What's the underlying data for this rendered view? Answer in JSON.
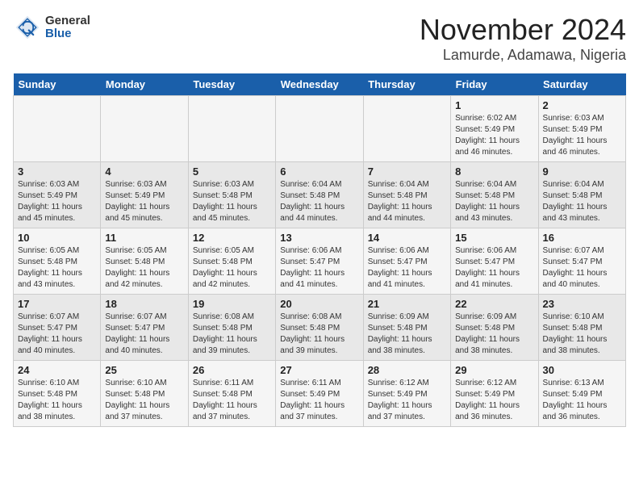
{
  "header": {
    "logo_general": "General",
    "logo_blue": "Blue",
    "month_title": "November 2024",
    "location": "Lamurde, Adamawa, Nigeria"
  },
  "days_of_week": [
    "Sunday",
    "Monday",
    "Tuesday",
    "Wednesday",
    "Thursday",
    "Friday",
    "Saturday"
  ],
  "weeks": [
    [
      {
        "day": "",
        "info": ""
      },
      {
        "day": "",
        "info": ""
      },
      {
        "day": "",
        "info": ""
      },
      {
        "day": "",
        "info": ""
      },
      {
        "day": "",
        "info": ""
      },
      {
        "day": "1",
        "info": "Sunrise: 6:02 AM\nSunset: 5:49 PM\nDaylight: 11 hours and 46 minutes."
      },
      {
        "day": "2",
        "info": "Sunrise: 6:03 AM\nSunset: 5:49 PM\nDaylight: 11 hours and 46 minutes."
      }
    ],
    [
      {
        "day": "3",
        "info": "Sunrise: 6:03 AM\nSunset: 5:49 PM\nDaylight: 11 hours and 45 minutes."
      },
      {
        "day": "4",
        "info": "Sunrise: 6:03 AM\nSunset: 5:49 PM\nDaylight: 11 hours and 45 minutes."
      },
      {
        "day": "5",
        "info": "Sunrise: 6:03 AM\nSunset: 5:48 PM\nDaylight: 11 hours and 45 minutes."
      },
      {
        "day": "6",
        "info": "Sunrise: 6:04 AM\nSunset: 5:48 PM\nDaylight: 11 hours and 44 minutes."
      },
      {
        "day": "7",
        "info": "Sunrise: 6:04 AM\nSunset: 5:48 PM\nDaylight: 11 hours and 44 minutes."
      },
      {
        "day": "8",
        "info": "Sunrise: 6:04 AM\nSunset: 5:48 PM\nDaylight: 11 hours and 43 minutes."
      },
      {
        "day": "9",
        "info": "Sunrise: 6:04 AM\nSunset: 5:48 PM\nDaylight: 11 hours and 43 minutes."
      }
    ],
    [
      {
        "day": "10",
        "info": "Sunrise: 6:05 AM\nSunset: 5:48 PM\nDaylight: 11 hours and 43 minutes."
      },
      {
        "day": "11",
        "info": "Sunrise: 6:05 AM\nSunset: 5:48 PM\nDaylight: 11 hours and 42 minutes."
      },
      {
        "day": "12",
        "info": "Sunrise: 6:05 AM\nSunset: 5:48 PM\nDaylight: 11 hours and 42 minutes."
      },
      {
        "day": "13",
        "info": "Sunrise: 6:06 AM\nSunset: 5:47 PM\nDaylight: 11 hours and 41 minutes."
      },
      {
        "day": "14",
        "info": "Sunrise: 6:06 AM\nSunset: 5:47 PM\nDaylight: 11 hours and 41 minutes."
      },
      {
        "day": "15",
        "info": "Sunrise: 6:06 AM\nSunset: 5:47 PM\nDaylight: 11 hours and 41 minutes."
      },
      {
        "day": "16",
        "info": "Sunrise: 6:07 AM\nSunset: 5:47 PM\nDaylight: 11 hours and 40 minutes."
      }
    ],
    [
      {
        "day": "17",
        "info": "Sunrise: 6:07 AM\nSunset: 5:47 PM\nDaylight: 11 hours and 40 minutes."
      },
      {
        "day": "18",
        "info": "Sunrise: 6:07 AM\nSunset: 5:47 PM\nDaylight: 11 hours and 40 minutes."
      },
      {
        "day": "19",
        "info": "Sunrise: 6:08 AM\nSunset: 5:48 PM\nDaylight: 11 hours and 39 minutes."
      },
      {
        "day": "20",
        "info": "Sunrise: 6:08 AM\nSunset: 5:48 PM\nDaylight: 11 hours and 39 minutes."
      },
      {
        "day": "21",
        "info": "Sunrise: 6:09 AM\nSunset: 5:48 PM\nDaylight: 11 hours and 38 minutes."
      },
      {
        "day": "22",
        "info": "Sunrise: 6:09 AM\nSunset: 5:48 PM\nDaylight: 11 hours and 38 minutes."
      },
      {
        "day": "23",
        "info": "Sunrise: 6:10 AM\nSunset: 5:48 PM\nDaylight: 11 hours and 38 minutes."
      }
    ],
    [
      {
        "day": "24",
        "info": "Sunrise: 6:10 AM\nSunset: 5:48 PM\nDaylight: 11 hours and 38 minutes."
      },
      {
        "day": "25",
        "info": "Sunrise: 6:10 AM\nSunset: 5:48 PM\nDaylight: 11 hours and 37 minutes."
      },
      {
        "day": "26",
        "info": "Sunrise: 6:11 AM\nSunset: 5:48 PM\nDaylight: 11 hours and 37 minutes."
      },
      {
        "day": "27",
        "info": "Sunrise: 6:11 AM\nSunset: 5:49 PM\nDaylight: 11 hours and 37 minutes."
      },
      {
        "day": "28",
        "info": "Sunrise: 6:12 AM\nSunset: 5:49 PM\nDaylight: 11 hours and 37 minutes."
      },
      {
        "day": "29",
        "info": "Sunrise: 6:12 AM\nSunset: 5:49 PM\nDaylight: 11 hours and 36 minutes."
      },
      {
        "day": "30",
        "info": "Sunrise: 6:13 AM\nSunset: 5:49 PM\nDaylight: 11 hours and 36 minutes."
      }
    ]
  ]
}
